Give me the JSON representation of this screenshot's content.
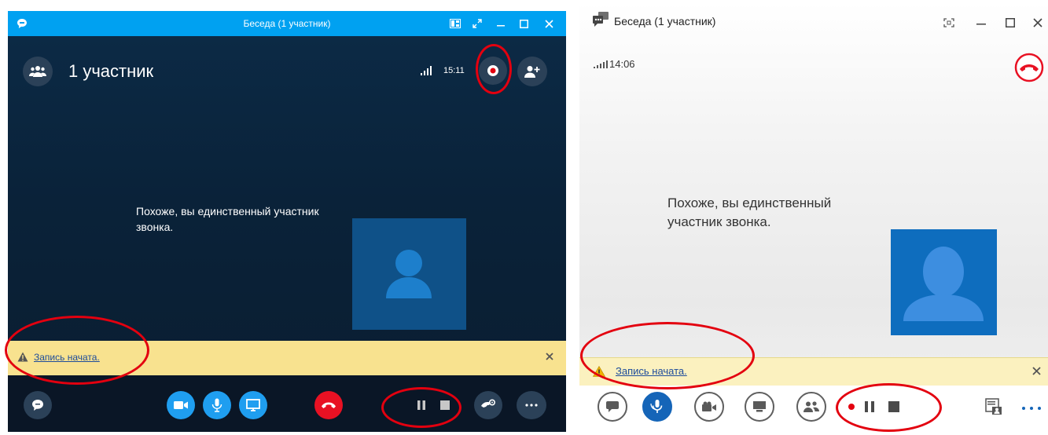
{
  "left_window": {
    "title": "Беседа (1 участник)",
    "participants_label": "1 участник",
    "time": "15:11",
    "message": "Похоже, вы единственный участник звонка.",
    "notification": "Запись начата.",
    "colors": {
      "titlebar": "#00a1f1",
      "background": "#0b2540",
      "controls_bar": "#0a1626",
      "notification": "#f8e28f",
      "action_blue": "#1f9ef0",
      "hangup_red": "#e81123"
    },
    "icons": {
      "app": "skype-chat-icon",
      "participants": "people-icon",
      "record": "record-icon",
      "add_person": "add-person-icon",
      "warning": "warning-icon",
      "close": "close-icon",
      "chat": "chat-icon",
      "video": "video-icon",
      "mic": "microphone-icon",
      "present": "present-screen-icon",
      "hangup": "hangup-icon",
      "pause": "pause-icon",
      "stop": "stop-icon",
      "call_controls": "call-controls-icon",
      "more": "more-icon"
    }
  },
  "right_window": {
    "title": "Беседа (1 участник)",
    "time": "14:06",
    "message": "Похоже, вы единственный участник звонка.",
    "notification": "Запись начата.",
    "colors": {
      "hangup_red": "#e81123",
      "mic_active": "#1565b8",
      "notification": "#fbf1bf",
      "avatar_tile": "#0e6dbe"
    },
    "icons": {
      "app": "lync-chat-icon",
      "hangup": "hangup-icon",
      "warning": "warning-icon",
      "close": "close-icon",
      "im": "chat-bubble-icon",
      "mic": "microphone-icon",
      "video": "video-camera-icon",
      "present": "monitor-icon",
      "participants": "people-icon",
      "record": "record-icon",
      "pause": "pause-icon",
      "stop": "stop-icon",
      "layout": "layout-icon",
      "more": "more-icon"
    }
  },
  "annotation_color": "#e3000f"
}
